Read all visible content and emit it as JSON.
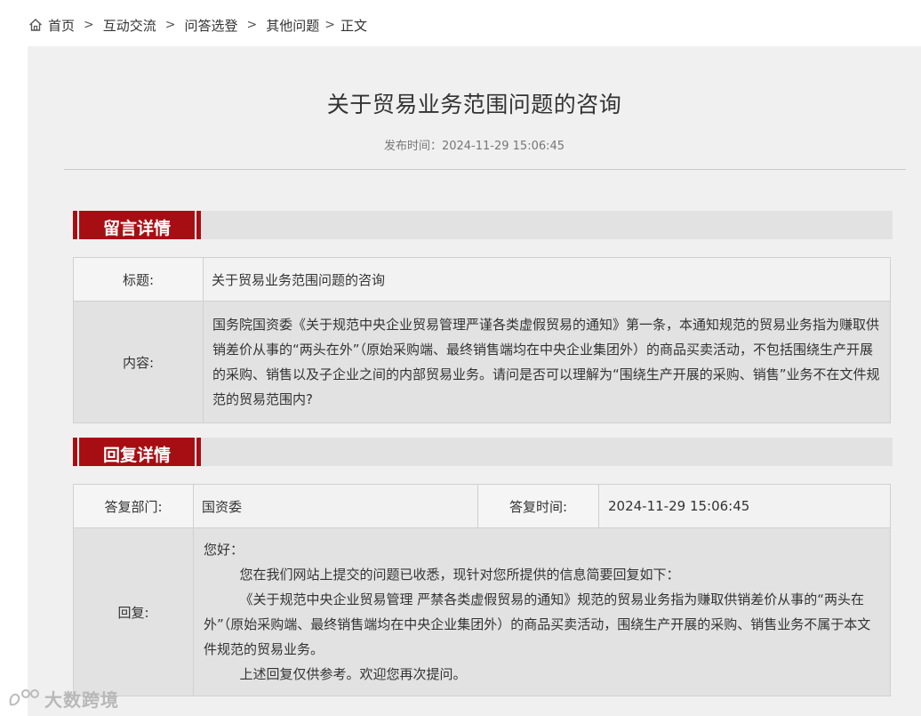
{
  "breadcrumb": {
    "items": [
      "首页",
      "互动交流",
      "问答选登",
      "其他问题",
      "正文"
    ],
    "separator": ">"
  },
  "article": {
    "title": "关于贸易业务范围问题的咨询",
    "publish_label": "发布时间：",
    "publish_time": "2024-11-29 15:06:45"
  },
  "message": {
    "section_title": "留言详情",
    "title_label": "标题:",
    "title_value": "关于贸易业务范围问题的咨询",
    "content_label": "内容:",
    "content_value": "国务院国资委《关于规范中央企业贸易管理严谨各类虚假贸易的通知》第一条，本通知规范的贸易业务指为赚取供销差价从事的“两头在外”（原始采购端、最终销售端均在中央企业集团外）的商品买卖活动，不包括围绕生产开展的采购、销售以及子企业之间的内部贸易业务。请问是否可以理解为“围绕生产开展的采购、销售”业务不在文件规范的贸易范围内?"
  },
  "reply": {
    "section_title": "回复详情",
    "dept_label": "答复部门:",
    "dept_value": "国资委",
    "time_label": "答复时间:",
    "time_value": "2024-11-29 15:06:45",
    "reply_label": "回复:",
    "greeting": "您好：",
    "line1": "您在我们网站上提交的问题已收悉，现针对您所提供的信息简要回复如下：",
    "line2": "《关于规范中央企业贸易管理 严禁各类虚假贸易的通知》规范的贸易业务指为赚取供销差价从事的“两头在外”（原始采购端、最终销售端均在中央企业集团外）的商品买卖活动，围绕生产开展的采购、销售业务不属于本文件规范的贸易业务。",
    "line3": "上述回复仅供参考。欢迎您再次提问。"
  },
  "watermark": {
    "text": "大数跨境"
  },
  "colors": {
    "accent": "#a70e13",
    "panel_bg": "#f0f0f0",
    "label_bg": "#e2e2e2"
  },
  "icons": {
    "home": "home-icon"
  }
}
